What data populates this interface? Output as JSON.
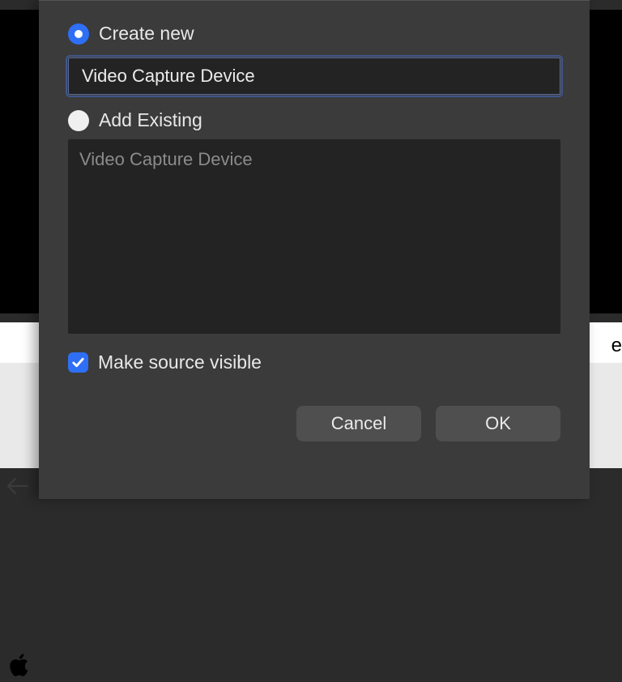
{
  "dialog": {
    "create_new": {
      "label": "Create new",
      "selected": true,
      "input_value": "Video Capture Device"
    },
    "add_existing": {
      "label": "Add Existing",
      "selected": false,
      "items": [
        "Video Capture Device"
      ]
    },
    "make_visible": {
      "label": "Make source visible",
      "checked": true
    },
    "buttons": {
      "cancel": "Cancel",
      "ok": "OK"
    }
  },
  "background": {
    "side_text_right": "e"
  }
}
